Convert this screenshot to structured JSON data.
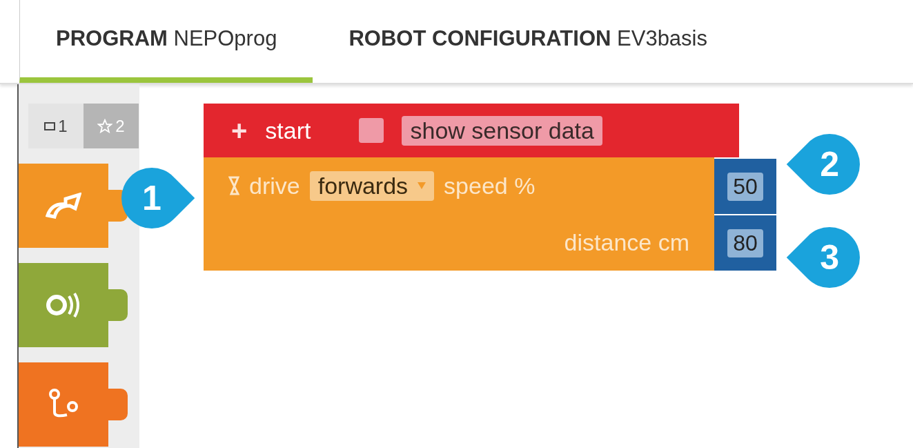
{
  "tabs": [
    {
      "label": "**PROGRAM** NEPOprog",
      "selected": true
    },
    {
      "label": "**ROBOT CONFIGURATION** EV3basis",
      "selected": false
    }
  ],
  "toolbox": {
    "levels": [
      {
        "kind": "square",
        "label": "1",
        "selected": false
      },
      {
        "kind": "star",
        "label": "2",
        "selected": true
      }
    ],
    "categories": [
      {
        "kind": "drive",
        "color": "#f29424"
      },
      {
        "kind": "sensor",
        "color": "#8fa83a"
      },
      {
        "kind": "control",
        "color": "#ef7321"
      }
    ]
  },
  "program": {
    "start": {
      "plus": "+",
      "label": "start",
      "checked": false,
      "option": "show sensor data"
    },
    "drive": {
      "label": "drive",
      "direction": "forwards",
      "speed_label": "speed %",
      "speed": "50",
      "distance_label": "distance cm",
      "distance": "80"
    }
  },
  "callouts": [
    "1",
    "2",
    "3"
  ]
}
